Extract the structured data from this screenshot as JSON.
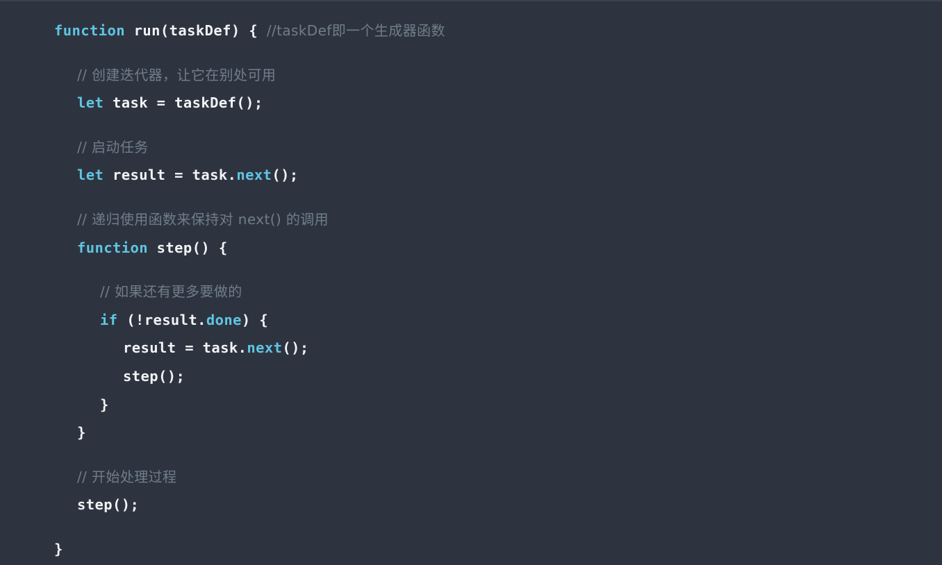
{
  "editor": {
    "language": "javascript",
    "theme_name": "dark-slate",
    "colors": {
      "background": "#2e343f",
      "top_border": "#39414e",
      "keyword": "#5fc5e3",
      "plain_text": "#f1f3f6",
      "comment": "#707d8c"
    }
  },
  "code": {
    "lines": [
      {
        "id": "line-1",
        "indent": 0,
        "type": "code",
        "tokens": [
          {
            "t": "kw",
            "v": "function"
          },
          {
            "t": "plain",
            "v": " run(taskDef) { "
          },
          {
            "t": "com",
            "v": "//taskDef即一个生成器函数"
          }
        ]
      },
      {
        "id": "line-2",
        "indent": 0,
        "type": "blank",
        "tokens": []
      },
      {
        "id": "line-3",
        "indent": 1,
        "type": "comment",
        "tokens": [
          {
            "t": "com",
            "v": "// 创建迭代器，让它在别处可用"
          }
        ]
      },
      {
        "id": "line-4",
        "indent": 1,
        "type": "code",
        "tokens": [
          {
            "t": "kw",
            "v": "let"
          },
          {
            "t": "plain",
            "v": " task = taskDef();"
          }
        ]
      },
      {
        "id": "line-5",
        "indent": 0,
        "type": "blank",
        "tokens": []
      },
      {
        "id": "line-6",
        "indent": 1,
        "type": "comment",
        "tokens": [
          {
            "t": "com",
            "v": "// 启动任务"
          }
        ]
      },
      {
        "id": "line-7",
        "indent": 1,
        "type": "code",
        "tokens": [
          {
            "t": "kw",
            "v": "let"
          },
          {
            "t": "plain",
            "v": " result = task."
          },
          {
            "t": "prop",
            "v": "next"
          },
          {
            "t": "plain",
            "v": "();"
          }
        ]
      },
      {
        "id": "line-8",
        "indent": 0,
        "type": "blank",
        "tokens": []
      },
      {
        "id": "line-9",
        "indent": 1,
        "type": "comment",
        "tokens": [
          {
            "t": "com",
            "v": "// 递归使用函数来保持对 next() 的调用"
          }
        ]
      },
      {
        "id": "line-10",
        "indent": 1,
        "type": "code",
        "tokens": [
          {
            "t": "kw",
            "v": "function"
          },
          {
            "t": "plain",
            "v": " step() {"
          }
        ]
      },
      {
        "id": "line-11",
        "indent": 0,
        "type": "blank",
        "tokens": []
      },
      {
        "id": "line-12",
        "indent": 2,
        "type": "comment",
        "tokens": [
          {
            "t": "com",
            "v": "// 如果还有更多要做的"
          }
        ]
      },
      {
        "id": "line-13",
        "indent": 2,
        "type": "code",
        "tokens": [
          {
            "t": "kw",
            "v": "if"
          },
          {
            "t": "plain",
            "v": " (!result."
          },
          {
            "t": "prop",
            "v": "done"
          },
          {
            "t": "plain",
            "v": ") {"
          }
        ]
      },
      {
        "id": "line-14",
        "indent": 3,
        "type": "code",
        "tokens": [
          {
            "t": "plain",
            "v": "result = task."
          },
          {
            "t": "prop",
            "v": "next"
          },
          {
            "t": "plain",
            "v": "();"
          }
        ]
      },
      {
        "id": "line-15",
        "indent": 3,
        "type": "code",
        "tokens": [
          {
            "t": "plain",
            "v": "step();"
          }
        ]
      },
      {
        "id": "line-16",
        "indent": 2,
        "type": "code",
        "tokens": [
          {
            "t": "plain",
            "v": "}"
          }
        ]
      },
      {
        "id": "line-17",
        "indent": 1,
        "type": "code",
        "tokens": [
          {
            "t": "plain",
            "v": "}"
          }
        ]
      },
      {
        "id": "line-18",
        "indent": 0,
        "type": "blank",
        "tokens": []
      },
      {
        "id": "line-19",
        "indent": 1,
        "type": "comment",
        "tokens": [
          {
            "t": "com",
            "v": "// 开始处理过程"
          }
        ]
      },
      {
        "id": "line-20",
        "indent": 1,
        "type": "code",
        "tokens": [
          {
            "t": "plain",
            "v": "step();"
          }
        ]
      },
      {
        "id": "line-21",
        "indent": 0,
        "type": "blank",
        "tokens": []
      },
      {
        "id": "line-22",
        "indent": 0,
        "type": "code",
        "tokens": [
          {
            "t": "plain",
            "v": "}"
          }
        ]
      }
    ]
  }
}
